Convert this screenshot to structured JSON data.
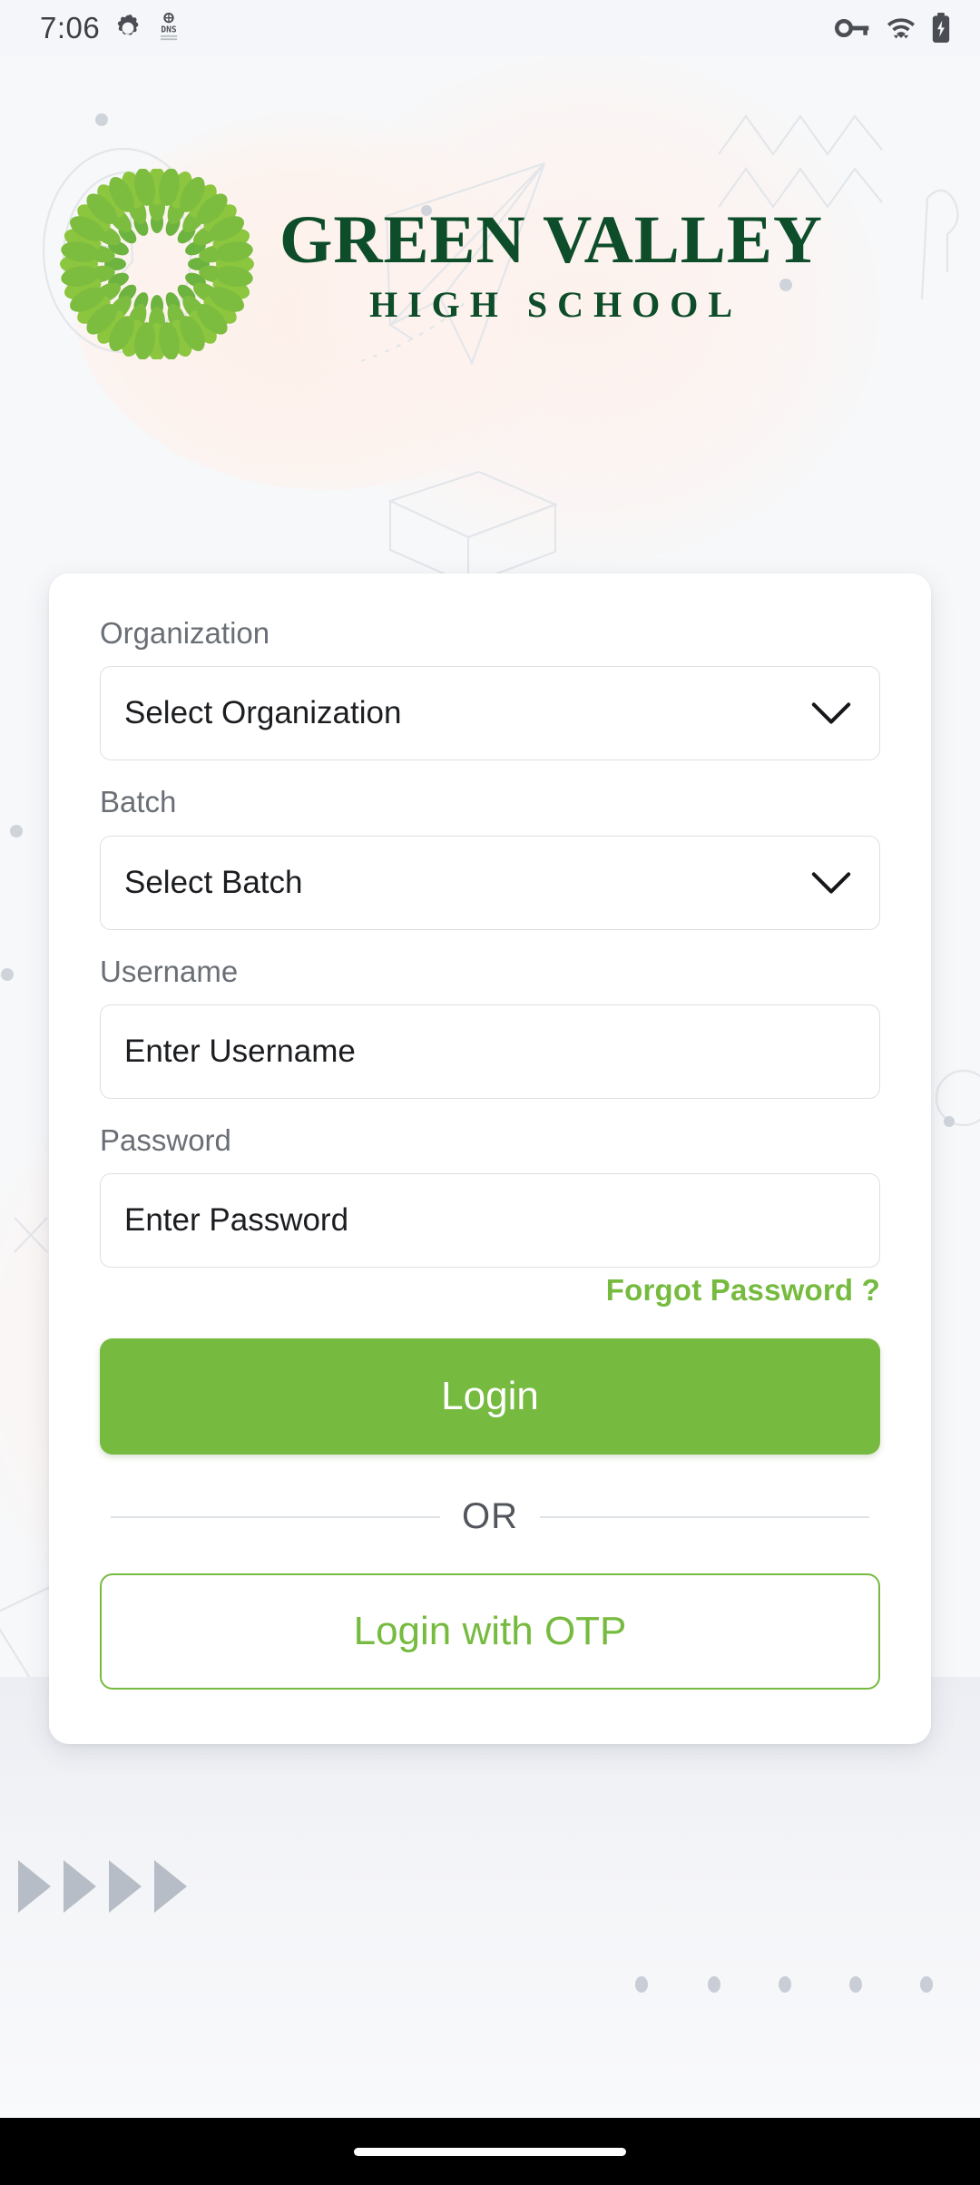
{
  "status_bar": {
    "time": "7:06",
    "left_icons": [
      "android-settings-icon",
      "dns-icon"
    ],
    "right_icons": [
      "vpn-key-icon",
      "wifi-icon",
      "battery-charging-icon"
    ]
  },
  "brand": {
    "logo_icon": "green-leaf-circle-logo",
    "title": "GREEN VALLEY",
    "subtitle": "HIGH SCHOOL",
    "title_color": "#0d4d2a",
    "leaf_colors": [
      "#7cbc3f",
      "#6cb33f",
      "#8cc63f"
    ]
  },
  "login_form": {
    "fields": [
      {
        "label": "Organization",
        "value": "Select Organization",
        "type": "select",
        "icon": "chevron-down-icon"
      },
      {
        "label": "Batch",
        "value": "Select Batch",
        "type": "select",
        "icon": "chevron-down-icon"
      },
      {
        "label": "Username",
        "value": "Enter Username",
        "type": "text"
      },
      {
        "label": "Password",
        "value": "Enter Password",
        "type": "password"
      }
    ],
    "forgot_password": "Forgot Password ?",
    "login_button": "Login",
    "divider": "OR",
    "otp_button": "Login with OTP",
    "accent_color": "#76bb3f"
  }
}
